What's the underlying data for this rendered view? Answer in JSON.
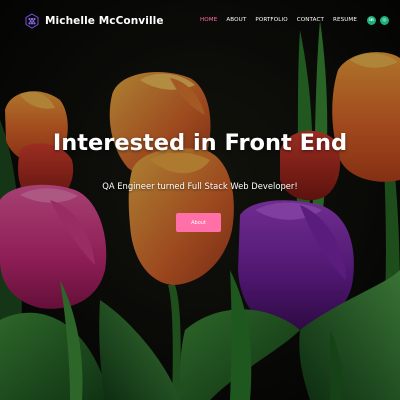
{
  "brand": {
    "name": "Michelle McConville",
    "logo_icon": "hexagon-dots-logo-icon"
  },
  "nav": {
    "items": [
      {
        "label": "HOME",
        "active": true
      },
      {
        "label": "ABOUT",
        "active": false
      },
      {
        "label": "PORTFOLIO",
        "active": false
      },
      {
        "label": "CONTACT",
        "active": false
      },
      {
        "label": "RESUME",
        "active": false
      }
    ],
    "active_color": "#ff6fa8"
  },
  "socials": [
    {
      "label": "in",
      "icon": "linkedin-icon"
    },
    {
      "label": "◎",
      "icon": "github-icon"
    }
  ],
  "hero": {
    "headline": "Interested in Front End",
    "subline": "QA Engineer turned Full Stack Web Developer!",
    "cta_label": "About",
    "background": "tulips-photo"
  },
  "colors": {
    "accent": "#ff6fa8",
    "social": "#18b37a"
  }
}
